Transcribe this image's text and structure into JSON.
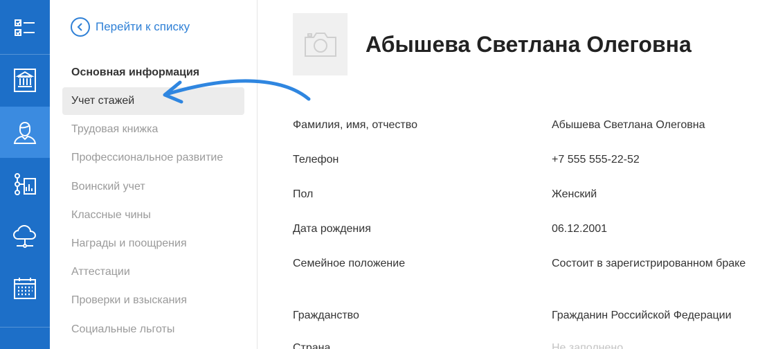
{
  "rail": {
    "items": [
      {
        "icon": "checklist-icon"
      },
      {
        "icon": "institution-icon"
      },
      {
        "icon": "person-icon",
        "active": true
      },
      {
        "icon": "org-chart-icon"
      },
      {
        "icon": "cloud-network-icon"
      },
      {
        "icon": "calendar-icon"
      }
    ]
  },
  "subnav": {
    "back_label": "Перейти к списку",
    "heading": "Основная информация",
    "items": [
      {
        "label": "Учет стажей",
        "active": true
      },
      {
        "label": "Трудовая книжка"
      },
      {
        "label": "Профессиональное развитие"
      },
      {
        "label": "Воинский учет"
      },
      {
        "label": "Классные чины"
      },
      {
        "label": "Награды и поощрения"
      },
      {
        "label": "Аттестации"
      },
      {
        "label": "Проверки и взыскания"
      },
      {
        "label": "Социальные льготы"
      }
    ]
  },
  "profile": {
    "name": "Абышева Светлана Олеговна",
    "fields": [
      {
        "label": "Фамилия, имя, отчество",
        "value": "Абышева Светлана Олеговна"
      },
      {
        "label": "Телефон",
        "value": "+7 555 555-22-52"
      },
      {
        "label": "Пол",
        "value": "Женский"
      },
      {
        "label": "Дата рождения",
        "value": "06.12.2001"
      },
      {
        "label": "Семейное положение",
        "value": "Состоит в зарегистрированном браке"
      },
      {
        "label": "Гражданство",
        "value": "Гражданин Российской Федерации"
      },
      {
        "label": "Страна",
        "value": "Не заполнено"
      }
    ]
  },
  "colors": {
    "rail": "#1d6fc8",
    "rail_active": "#3b8be0",
    "accent": "#2f80d6",
    "arrow": "#2f86e0"
  }
}
